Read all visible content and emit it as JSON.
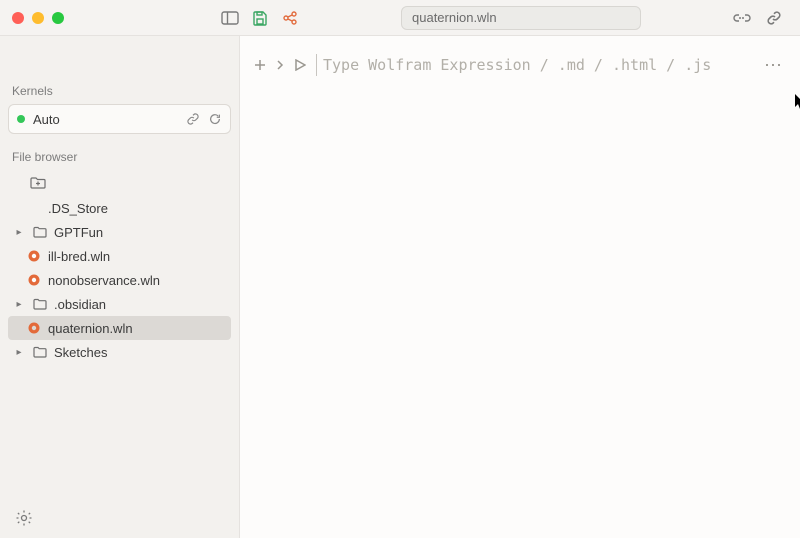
{
  "titlebar": {
    "filename": "quaternion.wln"
  },
  "sidebar": {
    "kernels_label": "Kernels",
    "kernel": {
      "name": "Auto"
    },
    "file_browser_label": "File browser",
    "items": [
      {
        "type": "newfolder"
      },
      {
        "type": "file",
        "name": ".DS_Store",
        "icon": "blank"
      },
      {
        "type": "folder",
        "name": "GPTFun",
        "expandable": true
      },
      {
        "type": "wln",
        "name": "ill-bred.wln"
      },
      {
        "type": "wln",
        "name": "nonobservance.wln"
      },
      {
        "type": "folder",
        "name": ".obsidian",
        "expandable": true
      },
      {
        "type": "wln",
        "name": "quaternion.wln",
        "selected": true
      },
      {
        "type": "folder",
        "name": "Sketches",
        "expandable": true
      }
    ]
  },
  "editor": {
    "placeholder": "Type Wolfram Expression / .md / .html / .js"
  }
}
